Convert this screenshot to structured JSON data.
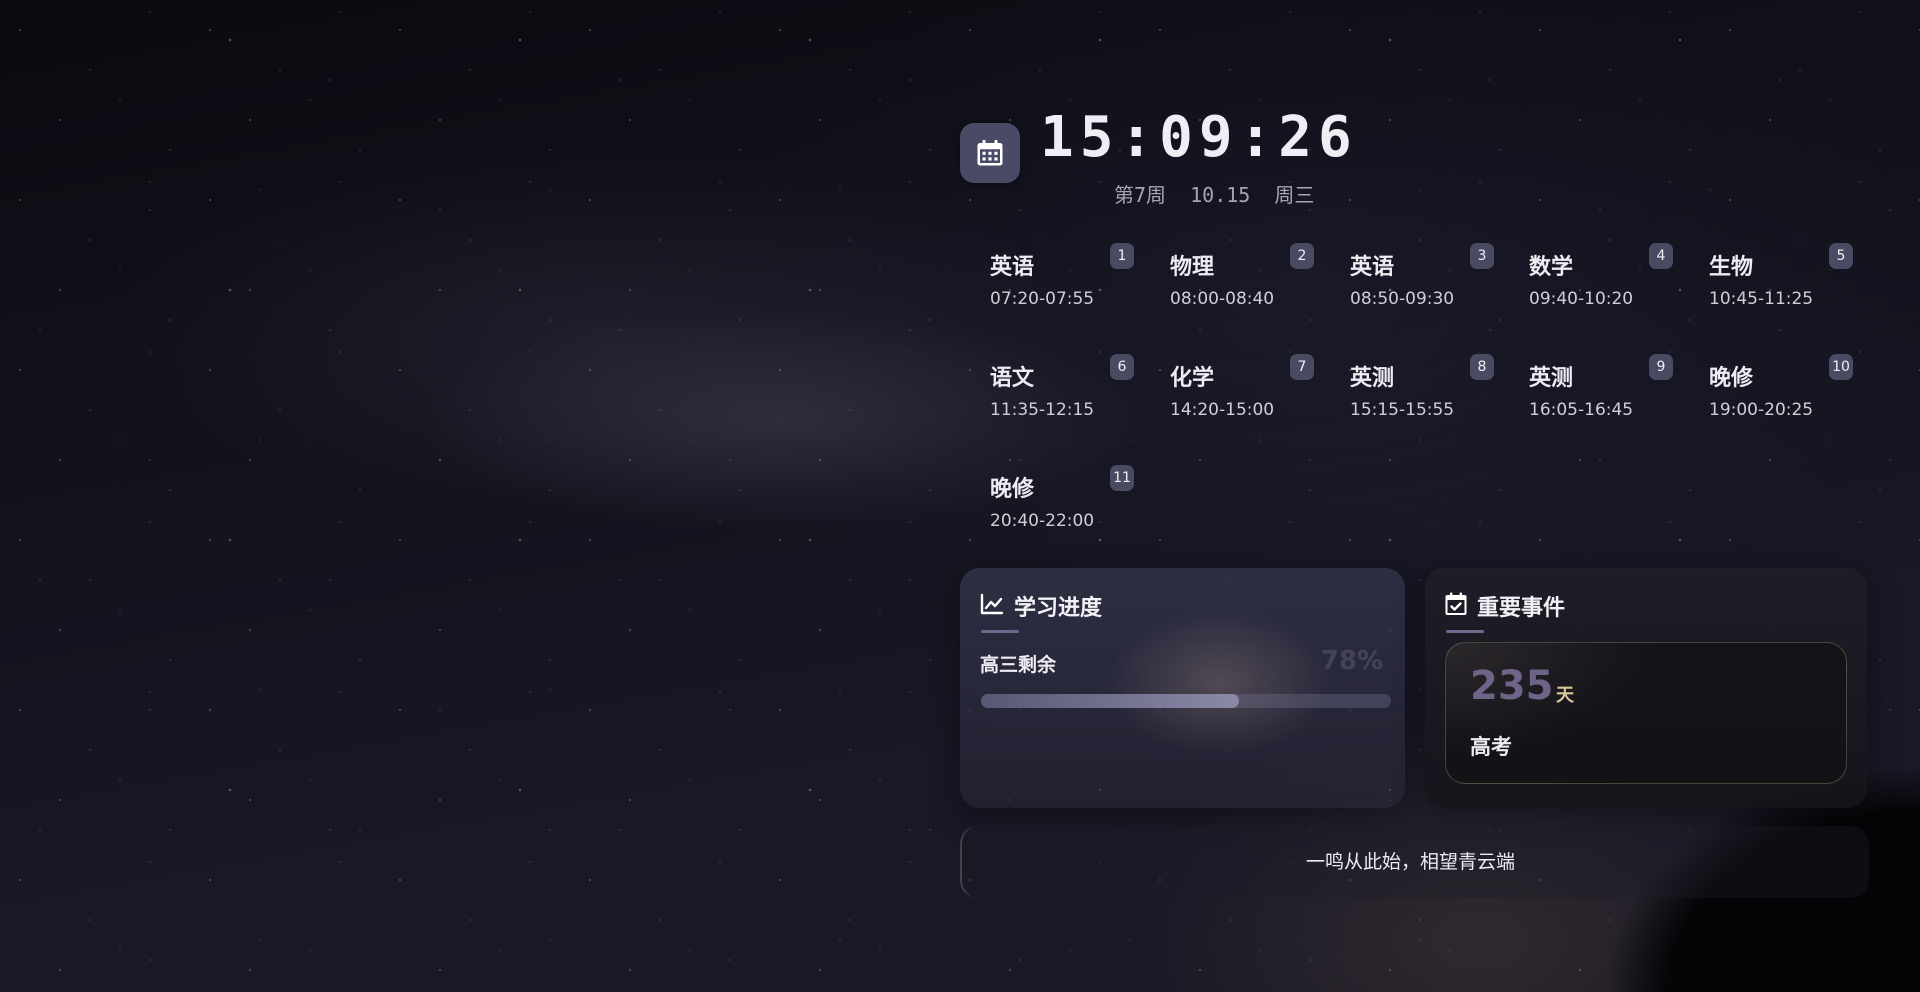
{
  "clock": {
    "time": "15:09:26",
    "date_line": "第7周  10.15  周三",
    "icon": "calendar-icon"
  },
  "schedule": [
    {
      "num": "1",
      "subject": "英语",
      "time": "07:20-07:55"
    },
    {
      "num": "2",
      "subject": "物理",
      "time": "08:00-08:40"
    },
    {
      "num": "3",
      "subject": "英语",
      "time": "08:50-09:30"
    },
    {
      "num": "4",
      "subject": "数学",
      "time": "09:40-10:20"
    },
    {
      "num": "5",
      "subject": "生物",
      "time": "10:45-11:25"
    },
    {
      "num": "6",
      "subject": "语文",
      "time": "11:35-12:15"
    },
    {
      "num": "7",
      "subject": "化学",
      "time": "14:20-15:00"
    },
    {
      "num": "8",
      "subject": "英测",
      "time": "15:15-15:55"
    },
    {
      "num": "9",
      "subject": "英测",
      "time": "16:05-16:45"
    },
    {
      "num": "10",
      "subject": "晚修",
      "time": "19:00-20:25"
    },
    {
      "num": "11",
      "subject": "晚修",
      "time": "20:40-22:00"
    }
  ],
  "progress": {
    "title": "学习进度",
    "icon": "chart-line-icon",
    "label": "高三剩余",
    "percent_text": "78%",
    "fill_fraction": 0.63
  },
  "events": {
    "title": "重要事件",
    "icon": "calendar-check-icon",
    "days": "235",
    "unit": "天",
    "name": "高考"
  },
  "quote": "一鸣从此始，相望青云端",
  "colors": {
    "accent": "#4a4a66",
    "badge": "#4a4a62",
    "days_number": "#6e6488",
    "days_unit": "#d8c79c"
  }
}
